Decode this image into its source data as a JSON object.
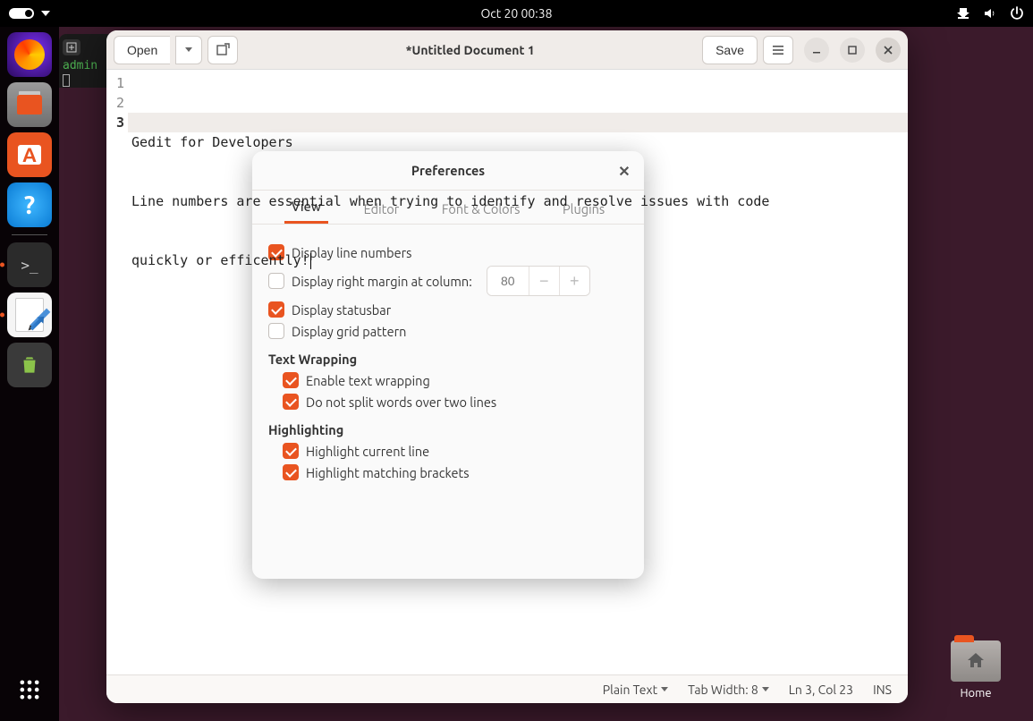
{
  "topbar": {
    "datetime": "Oct 20  00:38"
  },
  "dock": {
    "items": [
      "firefox",
      "files",
      "software",
      "help",
      "terminal",
      "gedit",
      "trash"
    ],
    "active": "gedit"
  },
  "desktop": {
    "home_label": "Home"
  },
  "terminal_peek": {
    "prompt": "admin"
  },
  "gedit": {
    "open_label": "Open",
    "save_label": "Save",
    "title": "*Untitled Document 1",
    "lines": [
      "Gedit for Developers",
      "Line numbers are essential when trying to identify and resolve issues with code",
      "quickly or efficently!"
    ],
    "current_line": 3,
    "statusbar": {
      "syntax": "Plain Text",
      "tab_width_label": "Tab Width: 8",
      "position": "Ln 3, Col 23",
      "insert_mode": "INS"
    }
  },
  "prefs": {
    "title": "Preferences",
    "tabs": [
      "View",
      "Editor",
      "Font & Colors",
      "Plugins"
    ],
    "active_tab": "View",
    "view": {
      "display_line_numbers": {
        "label": "Display line numbers",
        "checked": true
      },
      "display_right_margin": {
        "label": "Display right margin at column:",
        "checked": false,
        "value": "80"
      },
      "display_statusbar": {
        "label": "Display statusbar",
        "checked": true
      },
      "display_grid": {
        "label": "Display grid pattern",
        "checked": false
      },
      "text_wrapping_title": "Text Wrapping",
      "enable_wrap": {
        "label": "Enable text wrapping",
        "checked": true
      },
      "no_split": {
        "label": "Do not split words over two lines",
        "checked": true
      },
      "highlighting_title": "Highlighting",
      "hl_current": {
        "label": "Highlight current line",
        "checked": true
      },
      "hl_brackets": {
        "label": "Highlight matching brackets",
        "checked": true
      }
    }
  }
}
